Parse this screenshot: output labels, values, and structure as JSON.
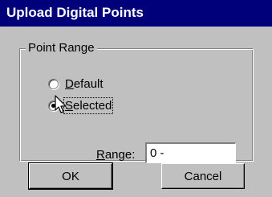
{
  "dialog": {
    "title": "Upload Digital Points"
  },
  "point_range": {
    "group_label": "Point Range",
    "options": [
      {
        "label_prefix": "",
        "mnemonic": "D",
        "label_rest": "efault",
        "selected": false
      },
      {
        "label_prefix": "",
        "mnemonic": "S",
        "label_rest": "elected",
        "selected": true
      }
    ],
    "range_label_prefix": "",
    "range_mnemonic": "R",
    "range_label_rest": "ange:",
    "range_value": "0 -"
  },
  "buttons": {
    "ok_label": "OK",
    "cancel_label": "Cancel"
  },
  "colors": {
    "titlebar": "#00007b",
    "face": "#c0c0c0"
  }
}
